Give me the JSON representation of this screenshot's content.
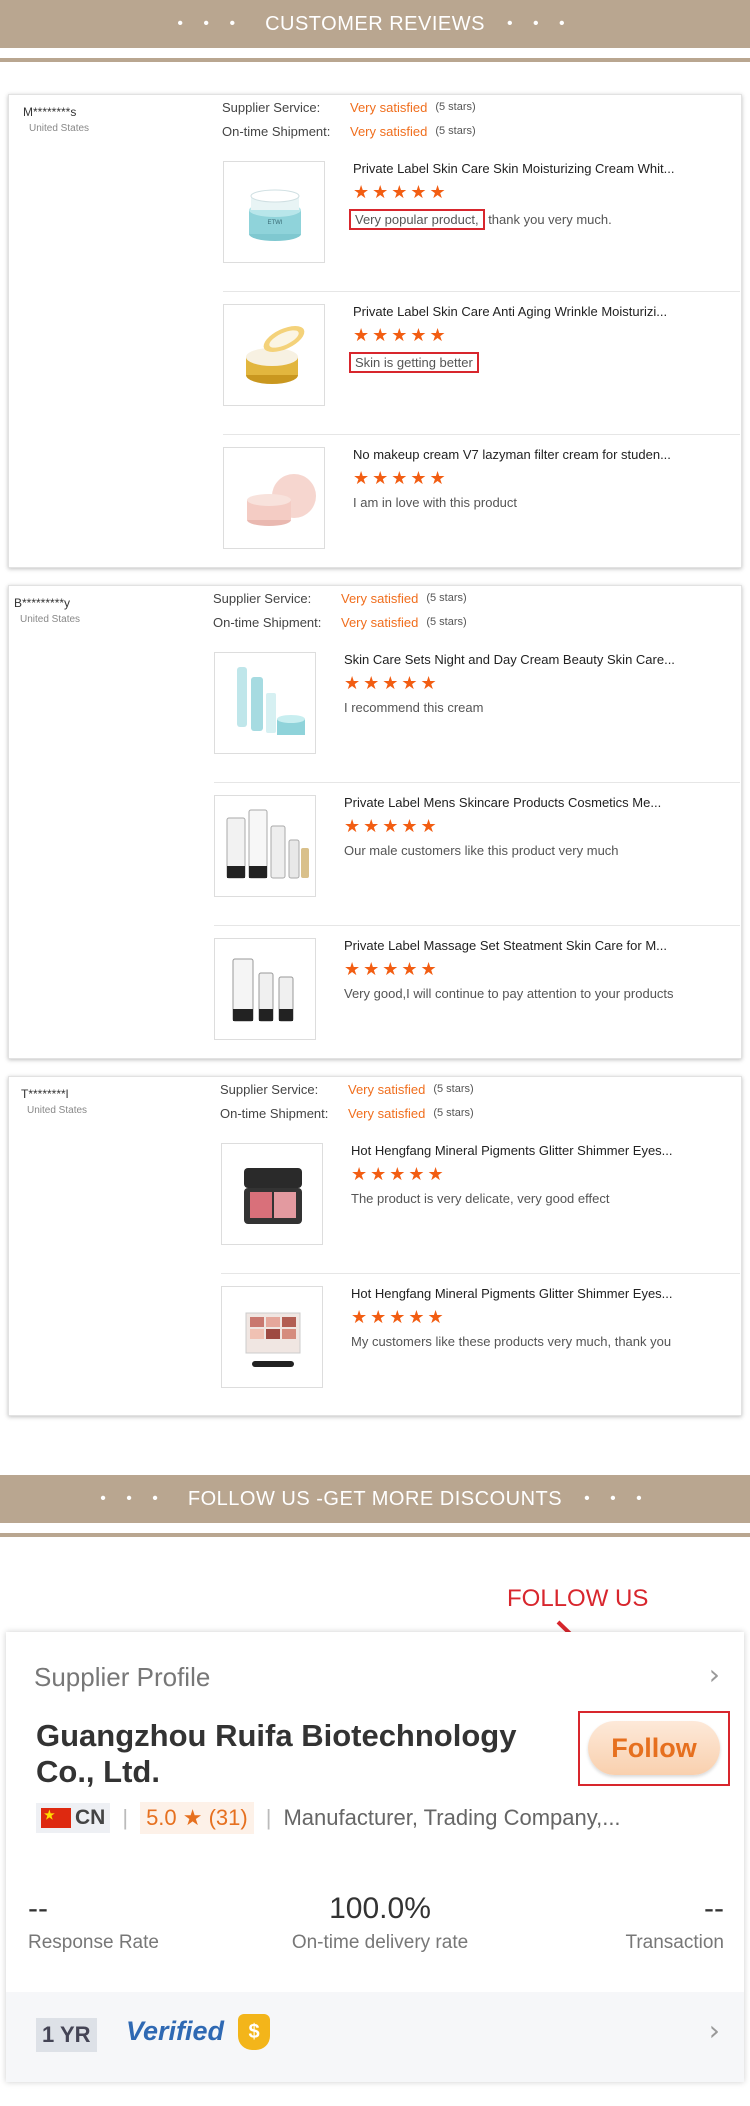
{
  "reviews_banner": {
    "title": "CUSTOMER REVIEWS",
    "dots": "• • •"
  },
  "reviews": [
    {
      "name": "M********s",
      "country": "United States",
      "supplier_service_label": "Supplier Service:",
      "supplier_service_value": "Very satisfied",
      "supplier_service_stars": "(5 stars)",
      "shipment_label": "On-time Shipment:",
      "shipment_value": "Very satisfied",
      "shipment_stars": "(5 stars)",
      "products": [
        {
          "title": "Private Label Skin Care Skin Moisturizing Cream Whit...",
          "stars": "★★★★★",
          "comment_highlight": "Very popular product,",
          "comment_rest": " thank you very much.",
          "rating": 5
        },
        {
          "title": "Private Label Skin Care Anti Aging Wrinkle Moisturizi...",
          "stars": "★★★★★",
          "comment_highlight": "Skin is getting better",
          "comment_rest": "",
          "rating": 5
        },
        {
          "title": "No makeup cream V7 lazyman filter cream for studen...",
          "stars": "★★★★★",
          "comment": "I am in love with this product",
          "rating": 5
        }
      ]
    },
    {
      "name": "B*********y",
      "country": "United States",
      "supplier_service_label": "Supplier Service:",
      "supplier_service_value": "Very satisfied",
      "supplier_service_stars": "(5 stars)",
      "shipment_label": "On-time Shipment:",
      "shipment_value": "Very satisfied",
      "shipment_stars": "(5 stars)",
      "products": [
        {
          "title": "Skin Care Sets Night and Day Cream Beauty Skin Care...",
          "stars": "★★★★★",
          "comment": "I recommend this cream",
          "rating": 5
        },
        {
          "title": "Private Label Mens Skincare Products Cosmetics Me...",
          "stars": "★★★★★",
          "comment": "Our male customers like this product very much",
          "rating": 5
        },
        {
          "title": "Private Label Massage Set Steatment Skin Care for M...",
          "stars": "★★★★★",
          "comment": "Very good,I will continue to pay attention to your products",
          "rating": 5
        }
      ]
    },
    {
      "name": "T********l",
      "country": "United States",
      "supplier_service_label": "Supplier Service:",
      "supplier_service_value": "Very satisfied",
      "supplier_service_stars": "(5 stars)",
      "shipment_label": "On-time Shipment:",
      "shipment_value": "Very satisfied",
      "shipment_stars": "(5 stars)",
      "products": [
        {
          "title": "Hot Hengfang Mineral Pigments Glitter Shimmer Eyes...",
          "stars": "★★★★★",
          "comment": "The product is very delicate, very good effect",
          "rating": 5
        },
        {
          "title": "Hot Hengfang Mineral Pigments Glitter Shimmer Eyes...",
          "stars": "★★★★★",
          "comment": "My customers like these products very much, thank you",
          "rating": 5
        }
      ]
    }
  ],
  "follow_banner": {
    "title": "FOLLOW US -GET MORE DISCOUNTS",
    "dots": "• • •"
  },
  "follow_hint": "FOLLOW US",
  "profile": {
    "heading": "Supplier Profile",
    "chevron": "›",
    "company": "Guangzhou Ruifa Biotechnology Co., Ltd.",
    "follow_label": "Follow",
    "country_code": "CN",
    "score": "5.0 ★",
    "review_count": "(31)",
    "business_type": "Manufacturer, Trading Company,...",
    "stats": [
      {
        "value": "--",
        "caption": "Response Rate"
      },
      {
        "value": "100.0%",
        "caption": "On-time delivery rate"
      },
      {
        "value": "--",
        "caption": "Transaction"
      }
    ],
    "years": "1 YR",
    "verified": "Verified",
    "verified_badge": "$"
  },
  "colors": {
    "banner": "#b9a690",
    "accent_orange": "#f06e1d",
    "star": "#f25d12",
    "highlight_red": "#d8262d"
  }
}
